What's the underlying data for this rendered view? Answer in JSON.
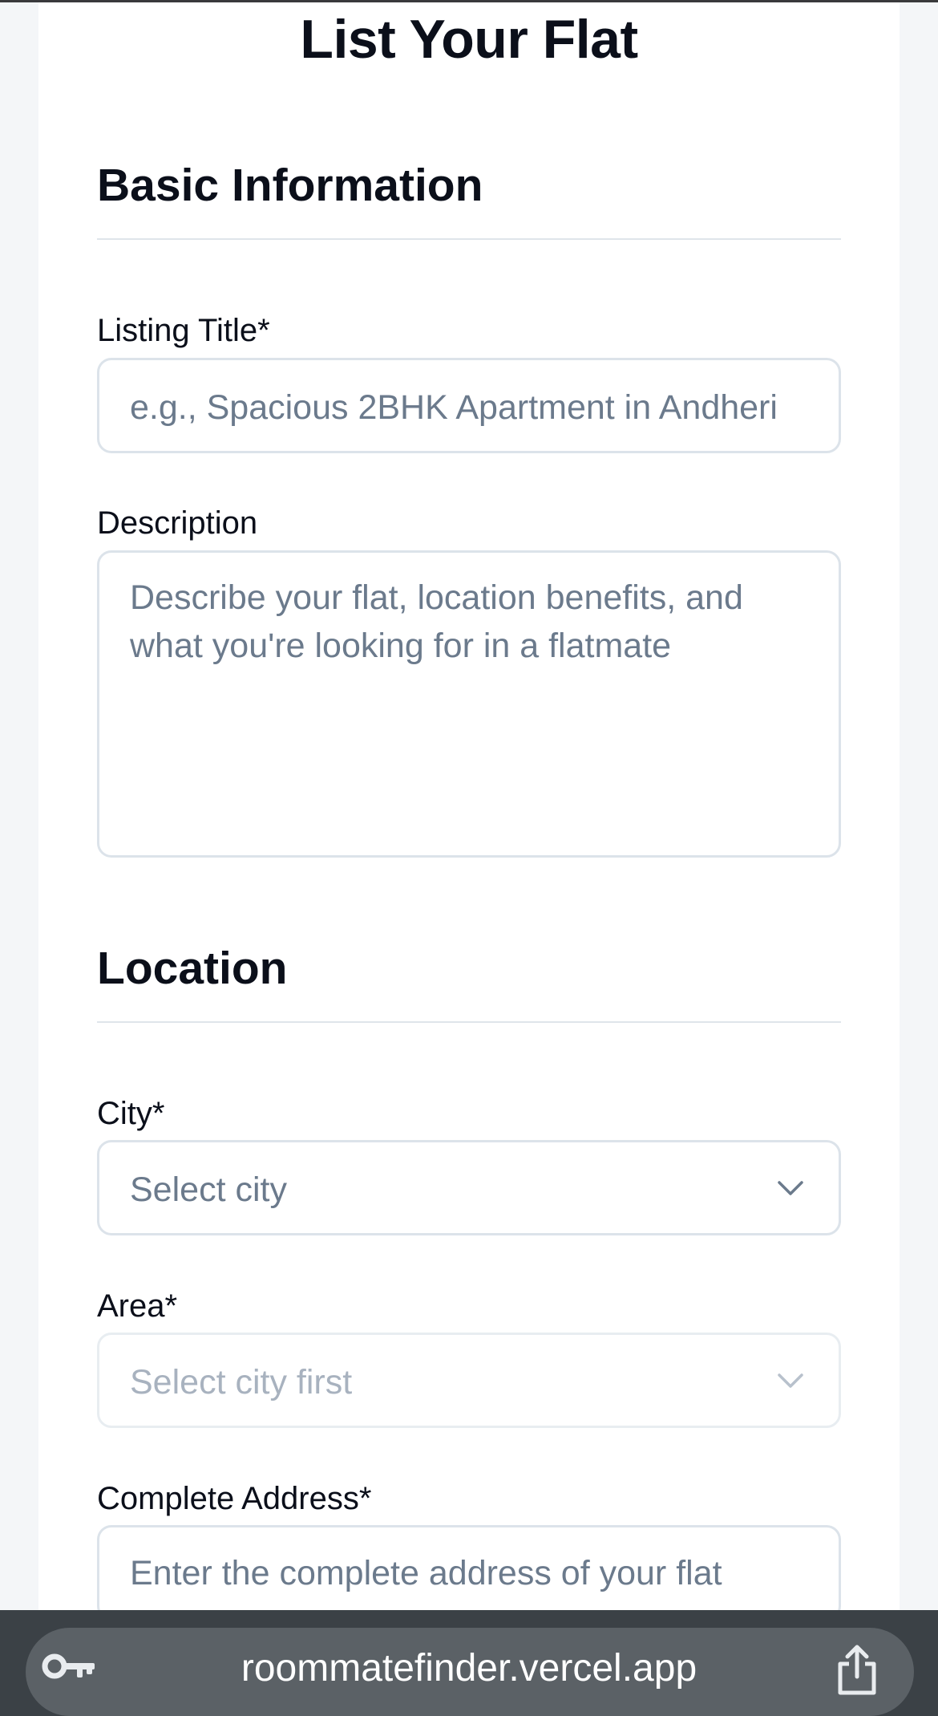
{
  "page": {
    "title": "List Your Flat"
  },
  "sections": {
    "basic": {
      "heading": "Basic Information",
      "title_label": "Listing Title*",
      "title_placeholder": "e.g., Spacious 2BHK Apartment in Andheri",
      "description_label": "Description",
      "description_placeholder": "Describe your flat, location benefits, and what you're looking for in a flatmate"
    },
    "location": {
      "heading": "Location",
      "city_label": "City*",
      "city_value": "Select city",
      "area_label": "Area*",
      "area_value": "Select city first",
      "address_label": "Complete Address*",
      "address_placeholder": "Enter the complete address of your flat"
    }
  },
  "browser": {
    "url": "roommatefinder.vercel.app"
  },
  "icons": {
    "key": "key-icon",
    "share": "share-icon",
    "chevron": "chevron-down-icon"
  }
}
